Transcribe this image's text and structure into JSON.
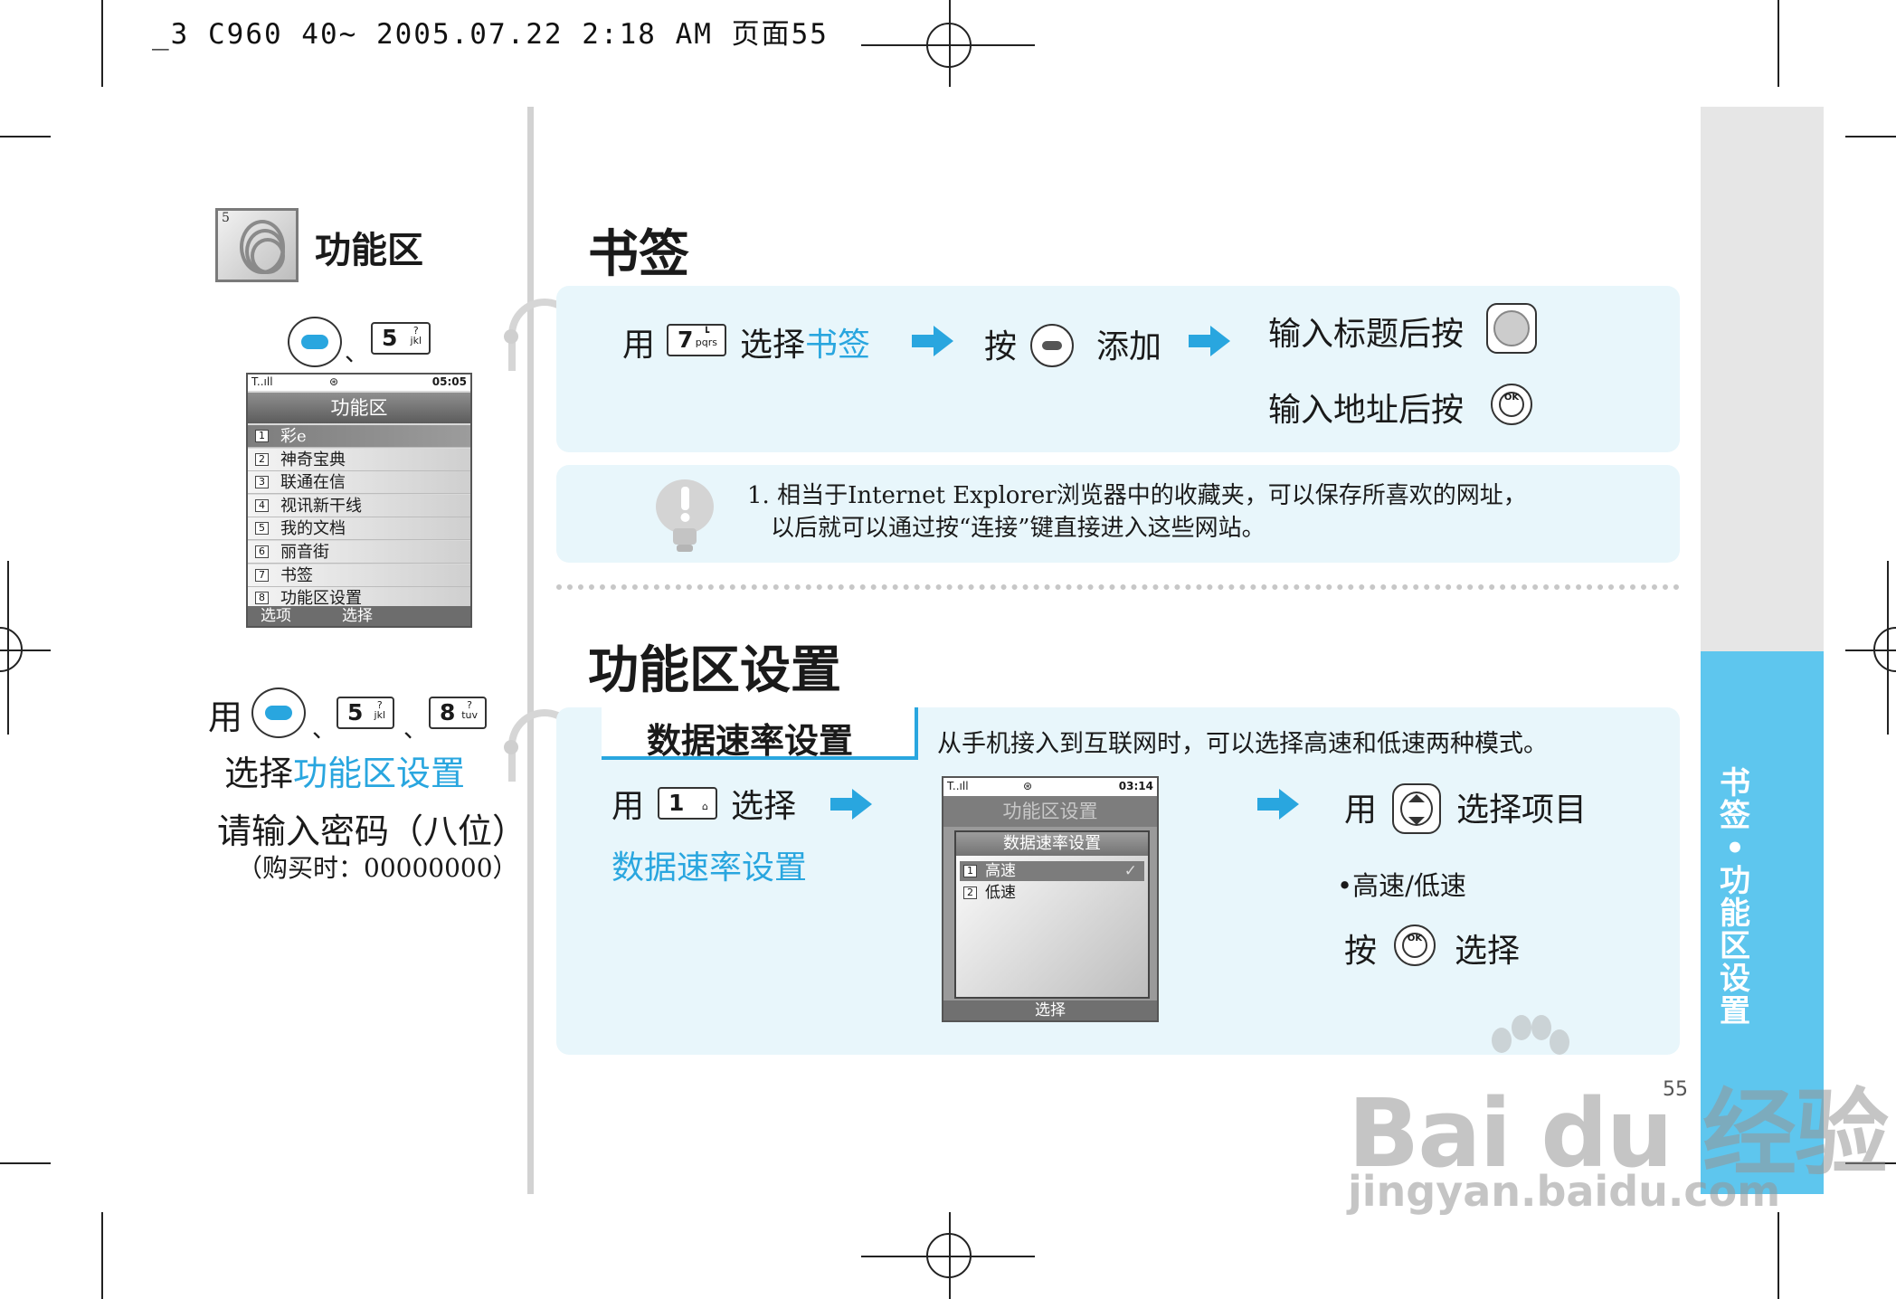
{
  "header": {
    "print_line": "_3 C960 40~ 2005.07.22 2:18 AM 页面55"
  },
  "left": {
    "menu_number": "5",
    "title": "功能区",
    "key_sep": "、",
    "key5": {
      "digit": "5",
      "sub": "?\njkl"
    },
    "key8": {
      "digit": "8",
      "sub": "?\ntuv"
    },
    "screen1": {
      "status_left": "T..ıll",
      "status_time": "05:05",
      "title": "功能区",
      "items": [
        {
          "n": "1",
          "label": "彩e"
        },
        {
          "n": "2",
          "label": "神奇宝典"
        },
        {
          "n": "3",
          "label": "联通在信"
        },
        {
          "n": "4",
          "label": "视讯新干线"
        },
        {
          "n": "5",
          "label": "我的文档"
        },
        {
          "n": "6",
          "label": "丽音街"
        },
        {
          "n": "7",
          "label": "书签"
        },
        {
          "n": "8",
          "label": "功能区设置"
        }
      ],
      "soft_left": "选项",
      "soft_right": "选择"
    },
    "use_prefix": "用",
    "select_prefix": "选择",
    "select_target": "功能区设置",
    "password_prompt": "请输入密码（八位）",
    "password_note": "（购买时：00000000）"
  },
  "bookmark": {
    "title": "书签",
    "use": "用",
    "key7": {
      "digit": "7",
      "sub": "┗\npqrs"
    },
    "select": "选择",
    "select_target": "书签",
    "press": "按",
    "add": "添加",
    "enter_title": "输入标题后按",
    "enter_url": "输入地址后按",
    "ok_label": "OK",
    "note_line1": "1. 相当于Internet Explorer浏览器中的收藏夹，可以保存所喜欢的网址，",
    "note_line2": "以后就可以通过按“连接”键直接进入这些网站。"
  },
  "settings": {
    "title": "功能区设置",
    "subtab": "数据速率设置",
    "description": "从手机接入到互联网时，可以选择高速和低速两种模式。",
    "use": "用",
    "key1": {
      "digit": "1",
      "sub": "⌂"
    },
    "select": "选择",
    "target": "数据速率设置",
    "screen2": {
      "status_left": "T..ıll",
      "status_time": "03:14",
      "bg_title": "功能区设置",
      "dialog_title": "数据速率设置",
      "items": [
        {
          "n": "1",
          "label": "高速",
          "check": "✓"
        },
        {
          "n": "2",
          "label": "低速",
          "check": ""
        }
      ],
      "soft_center": "选择"
    },
    "use2": "用",
    "select_item": "选择项目",
    "options": "•高速/低速",
    "press": "按",
    "select2": "选择"
  },
  "side_tab": {
    "chars": [
      "书",
      "签",
      "•",
      "功",
      "能",
      "区",
      "设",
      "置"
    ]
  },
  "page_number": "55",
  "watermark": {
    "main": "Bai du 经验",
    "url": "jingyan.baidu.com"
  },
  "colors": {
    "accent": "#29a6df",
    "panel": "#e8f6fb",
    "tab_blue": "#5ec6ee"
  }
}
